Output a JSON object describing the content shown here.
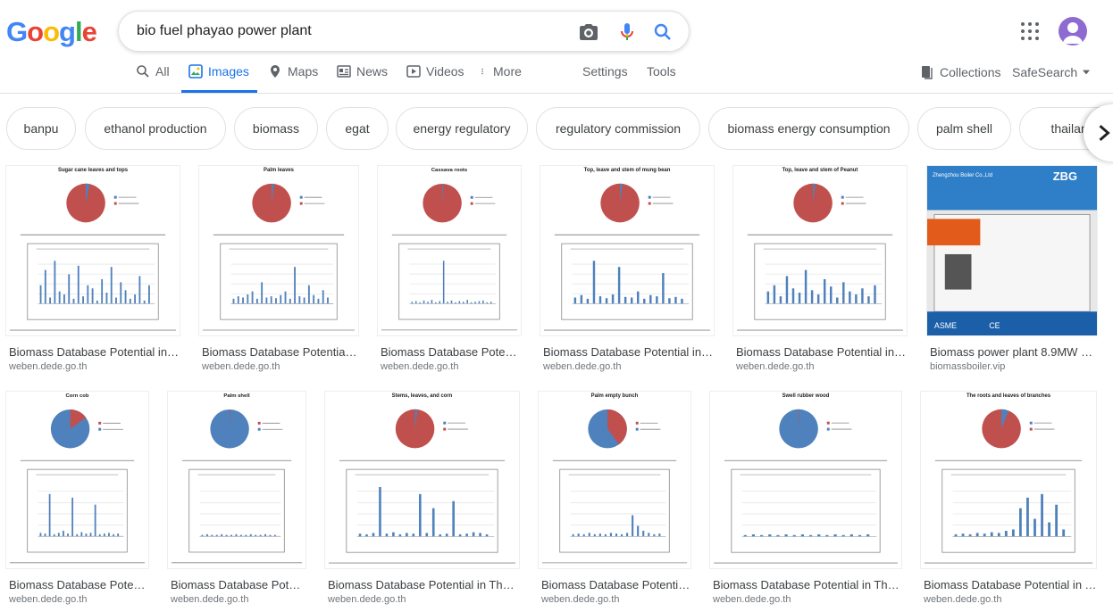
{
  "header": {
    "query": "bio fuel phayao power plant",
    "logo_letters": [
      {
        "ch": "G",
        "color": "#4285f4"
      },
      {
        "ch": "o",
        "color": "#ea4335"
      },
      {
        "ch": "o",
        "color": "#fbbc05"
      },
      {
        "ch": "g",
        "color": "#4285f4"
      },
      {
        "ch": "l",
        "color": "#34a853"
      },
      {
        "ch": "e",
        "color": "#ea4335"
      }
    ]
  },
  "tabs": {
    "all": "All",
    "images": "Images",
    "maps": "Maps",
    "news": "News",
    "videos": "Videos",
    "more": "More",
    "settings": "Settings",
    "tools": "Tools",
    "collections": "Collections",
    "safesearch": "SafeSearch"
  },
  "chips": [
    "banpu",
    "ethanol production",
    "biomass",
    "egat",
    "energy regulatory",
    "regulatory commission",
    "biomass energy consumption",
    "palm shell",
    "thailand"
  ],
  "results": [
    {
      "title": "Biomass Database Potential in T...",
      "source": "weben.dede.go.th",
      "chart_title": "Sugar cane leaves and tops"
    },
    {
      "title": "Biomass Database Potential i...",
      "source": "weben.dede.go.th",
      "chart_title": "Palm leaves"
    },
    {
      "title": "Biomass Database Potent...",
      "source": "weben.dede.go.th",
      "chart_title": "Cassava roots"
    },
    {
      "title": "Biomass Database Potential in T...",
      "source": "weben.dede.go.th",
      "chart_title": "Top, leave and stem of mung bean"
    },
    {
      "title": "Biomass Database Potential in T...",
      "source": "weben.dede.go.th",
      "chart_title": "Top, leave and stem of Peanut"
    },
    {
      "title": "Biomass power plant 8.9MW – ...",
      "source": "biomassboiler.vip",
      "brand": "ZBG",
      "company": "Zhengzhou Boiler Co.,Ltd",
      "asme": "ASME",
      "ce": "CE"
    },
    {
      "title": "Biomass Database Potent...",
      "source": "weben.dede.go.th",
      "chart_title": "Corn cob"
    },
    {
      "title": "Biomass Database Poten...",
      "source": "weben.dede.go.th",
      "chart_title": "Palm shell"
    },
    {
      "title": "Biomass Database Potential in Thail...",
      "source": "weben.dede.go.th",
      "chart_title": "Stems, leaves, and corn"
    },
    {
      "title": "Biomass Database Potential...",
      "source": "weben.dede.go.th",
      "chart_title": "Palm empty bunch"
    },
    {
      "title": "Biomass Database Potential in Thai...",
      "source": "weben.dede.go.th",
      "chart_title": "Swell rubber wood"
    },
    {
      "title": "Biomass Database Potential in T...",
      "source": "weben.dede.go.th",
      "chart_title": "The roots and leaves of branches"
    }
  ],
  "colors": {
    "accent": "#1a73e8",
    "pie_red": "#c0504d",
    "pie_blue": "#4f81bd"
  }
}
